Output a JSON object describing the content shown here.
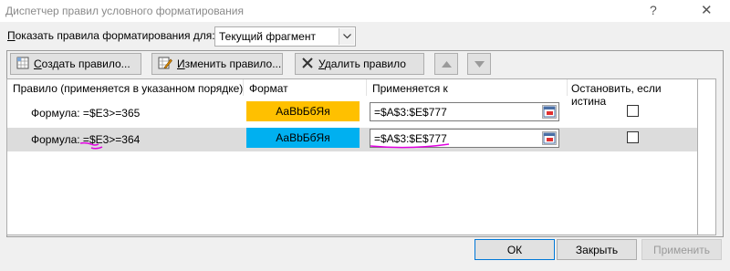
{
  "window": {
    "title": "Диспетчер правил условного форматирования",
    "help_glyph": "?",
    "close_glyph": "✕"
  },
  "show_rules": {
    "label_lead": "П",
    "label_rest": "оказать правила форматирования для:",
    "selected": "Текущий фрагмент"
  },
  "toolbar": {
    "create_lead": "С",
    "create_rest": "оздать правило...",
    "edit_lead": "И",
    "edit_rest": "зменить правило...",
    "delete_lead": "У",
    "delete_rest": "далить правило"
  },
  "columns": {
    "rule": "Правило (применяется в указанном порядке)",
    "format": "Формат",
    "applies_to": "Применяется к",
    "stop_if_true": "Остановить, если истина"
  },
  "rules": [
    {
      "formula": "Формула: =$E3>=365",
      "format_preview": "АаВbБбЯя",
      "format_color": "#ffc000",
      "applies_to": "=$A$3:$E$777",
      "stop_if_true": false
    },
    {
      "formula": "Формула: =$E3>=364",
      "format_preview": "АаВbБбЯя",
      "format_color": "#00b0f0",
      "applies_to": "=$A$3:$E$777",
      "stop_if_true": false
    }
  ],
  "buttons": {
    "ok": "ОК",
    "close": "Закрыть",
    "apply": "Применить"
  },
  "colors": {
    "annotation": "#e000e0",
    "selection": "#dcdcdc"
  }
}
